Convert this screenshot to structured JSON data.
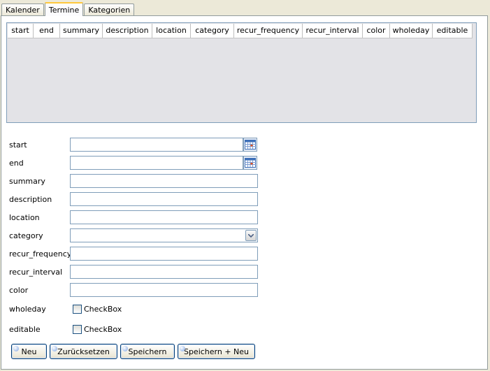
{
  "tabs": [
    {
      "label": "Kalender",
      "active": false
    },
    {
      "label": "Termine",
      "active": true
    },
    {
      "label": "Kategorien",
      "active": false
    }
  ],
  "grid": {
    "columns": [
      "start",
      "end",
      "summary",
      "description",
      "location",
      "category",
      "recur_frequency",
      "recur_interval",
      "color",
      "wholeday",
      "editable"
    ],
    "rows": []
  },
  "form": {
    "start": {
      "label": "start",
      "value": ""
    },
    "end": {
      "label": "end",
      "value": ""
    },
    "summary": {
      "label": "summary",
      "value": ""
    },
    "description": {
      "label": "description",
      "value": ""
    },
    "location": {
      "label": "location",
      "value": ""
    },
    "category": {
      "label": "category",
      "value": ""
    },
    "recur_frequency": {
      "label": "recur_frequency",
      "value": ""
    },
    "recur_interval": {
      "label": "recur_interval",
      "value": ""
    },
    "color": {
      "label": "color",
      "value": ""
    },
    "wholeday": {
      "label": "wholeday",
      "checkbox_label": "CheckBox",
      "checked": false
    },
    "editable": {
      "label": "editable",
      "checkbox_label": "CheckBox",
      "checked": false
    }
  },
  "buttons": {
    "new": "Neu",
    "reset": "Zurücksetzen",
    "save": "Speichern",
    "save_new": "Speichern + Neu"
  },
  "colors": {
    "window_bg": "#ece9d8",
    "active_tab_highlight": "#ffc83c",
    "grid_bg": "#e3e3e7",
    "field_border": "#7f9db9"
  }
}
